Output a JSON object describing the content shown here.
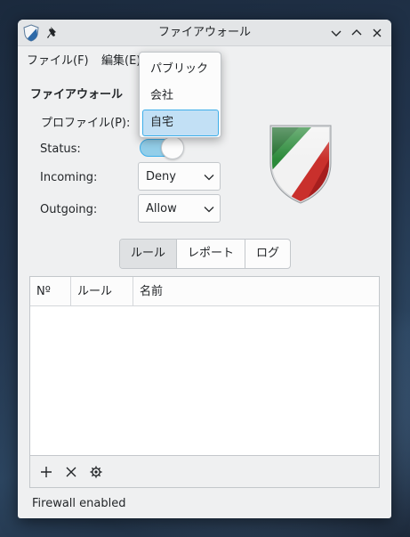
{
  "window": {
    "title": "ファイアウォール"
  },
  "menubar": {
    "file": "ファイル(F)",
    "edit": "編集(E)"
  },
  "section_title": "ファイアウォール",
  "form": {
    "profile_label": "プロファイル(P):",
    "status_label": "Status:",
    "incoming_label": "Incoming:",
    "incoming_value": "Deny",
    "outgoing_label": "Outgoing:",
    "outgoing_value": "Allow",
    "status_on": true
  },
  "profile_dropdown": {
    "items": [
      "パブリック",
      "会社",
      "自宅"
    ],
    "selected": "自宅"
  },
  "tabs": [
    "ルール",
    "レポート",
    "ログ"
  ],
  "active_tab": "ルール",
  "table": {
    "columns": [
      "Nº",
      "ルール",
      "名前"
    ],
    "rows": []
  },
  "toolbar": {
    "icons": [
      "plus-icon",
      "x-icon",
      "gear-icon"
    ]
  },
  "statusbar": {
    "text": "Firewall enabled"
  },
  "colors": {
    "accent": "#3daee9",
    "selection": "#c2e0f5",
    "window_bg": "#eff0f1"
  }
}
